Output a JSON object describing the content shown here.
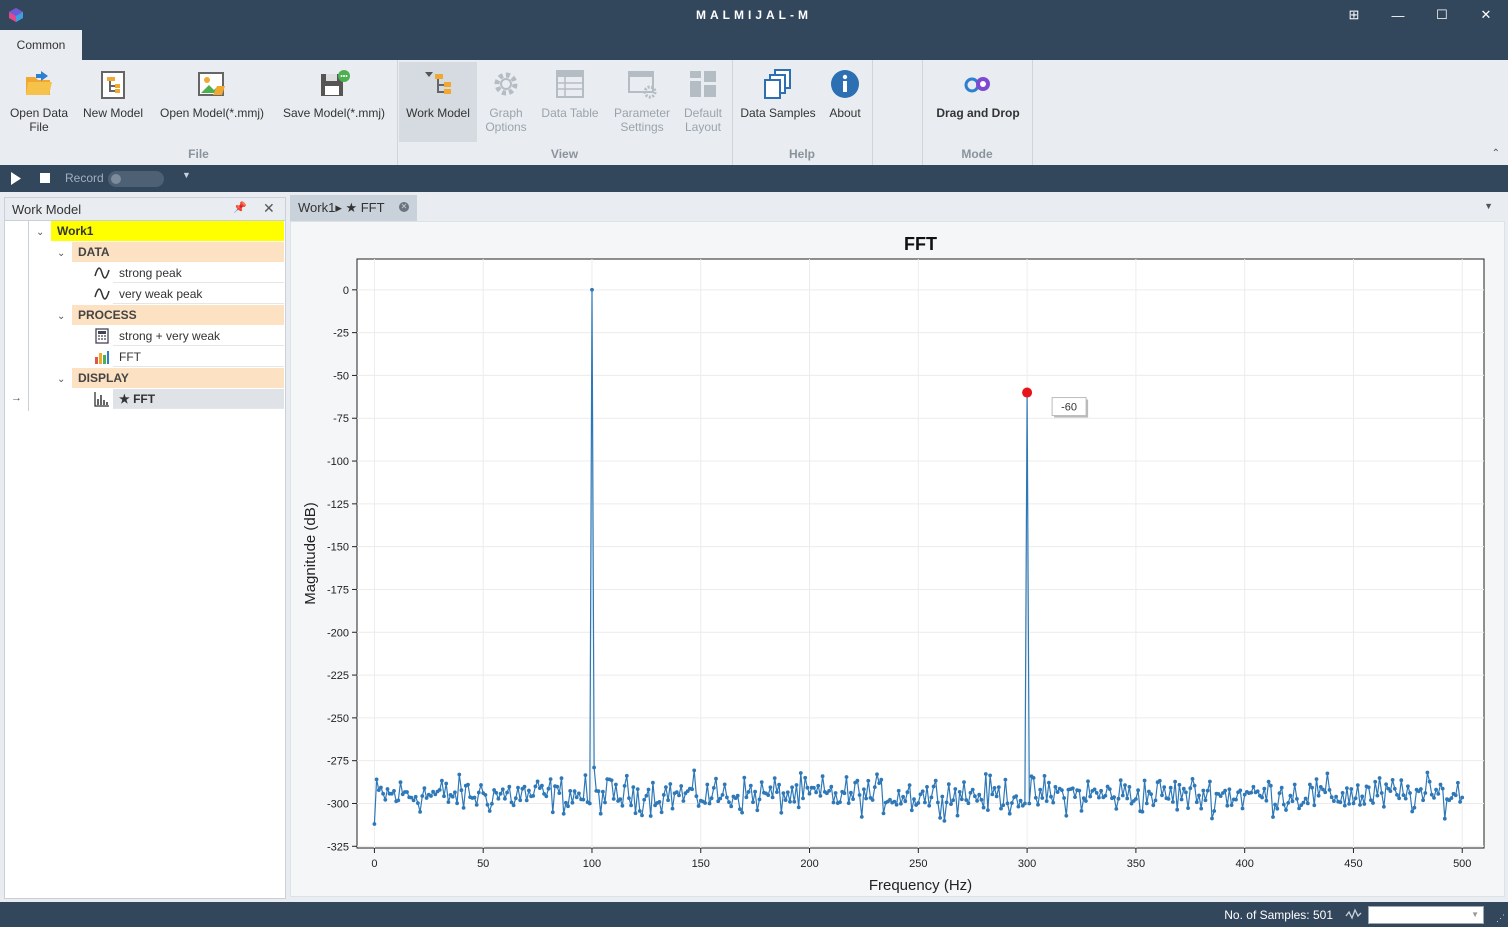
{
  "window": {
    "title": "MALMIJAL-M",
    "controls": [
      "⊞",
      "—",
      "☐",
      "✕"
    ]
  },
  "ribbon": {
    "tab": "Common",
    "groups": {
      "file": {
        "label": "File",
        "buttons": {
          "open_data_file": "Open Data\nFile",
          "new_model": "New Model",
          "open_model": "Open Model(*.mmj)",
          "save_model": "Save Model(*.mmj)"
        }
      },
      "view": {
        "label": "View",
        "buttons": {
          "work_model": "Work Model",
          "graph_options": "Graph\nOptions",
          "data_table": "Data Table",
          "parameter_settings": "Parameter\nSettings",
          "default_layout": "Default\nLayout"
        }
      },
      "help": {
        "label": "Help",
        "buttons": {
          "data_samples": "Data Samples",
          "about": "About"
        }
      },
      "mode": {
        "label": "Mode",
        "buttons": {
          "drag_and_drop": "Drag and Drop"
        }
      }
    }
  },
  "toolbar": {
    "record_label": "Record"
  },
  "work_model": {
    "title": "Work Model",
    "root": "Work1",
    "categories": {
      "data": {
        "label": "DATA",
        "items": [
          "strong peak",
          "very weak peak"
        ]
      },
      "process": {
        "label": "PROCESS",
        "items": [
          "strong + very weak",
          "FFT"
        ]
      },
      "display": {
        "label": "DISPLAY",
        "items": [
          "★ FFT"
        ]
      }
    }
  },
  "document": {
    "tab_label": "Work1▸ ★ FFT"
  },
  "chart_data": {
    "type": "line",
    "title": "FFT",
    "xlabel": "Frequency (Hz)",
    "ylabel": "Magnitude (dB)",
    "xlim": [
      -8,
      510
    ],
    "ylim": [
      -326,
      18
    ],
    "xticks": [
      0,
      50,
      100,
      150,
      200,
      250,
      300,
      350,
      400,
      450,
      500
    ],
    "yticks": [
      0,
      -25,
      -50,
      -75,
      -100,
      -125,
      -150,
      -175,
      -200,
      -225,
      -250,
      -275,
      -300,
      -325
    ],
    "grid": true,
    "series": [
      {
        "color": "#2e78b7",
        "noise_floor_db": -290,
        "noise_range_db": [
          -312,
          -280
        ],
        "x_range": [
          0,
          500
        ],
        "n_points": 501,
        "peaks": [
          {
            "x": 100,
            "y": 0
          },
          {
            "x": 300,
            "y": -60
          }
        ]
      }
    ],
    "highlight": {
      "x": 300,
      "y": -60,
      "label": "-60",
      "color": "#e8141b"
    }
  },
  "status": {
    "samples_text": "No. of Samples: 501"
  }
}
